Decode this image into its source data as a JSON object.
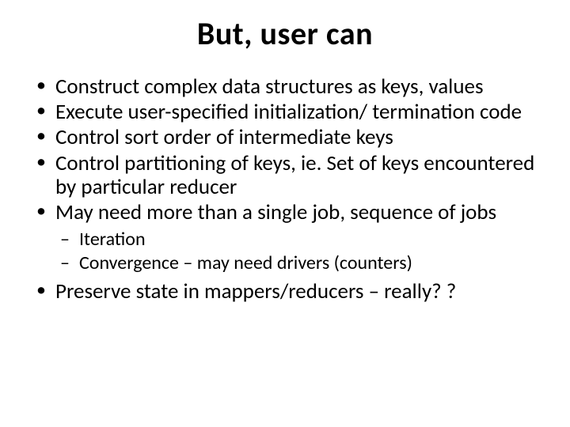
{
  "title": "But, user can",
  "bullets": [
    "Construct complex data structures as keys, values",
    "Execute user-specified initialization/ termination code",
    "Control sort order of intermediate keys",
    "Control partitioning of keys, ie. Set of keys encountered by particular reducer",
    "May need more than a single job, sequence of jobs"
  ],
  "sub_bullets": [
    "Iteration",
    "Convergence – may need drivers (counters)"
  ],
  "last_bullet": "Preserve state in mappers/reducers – really? ?"
}
